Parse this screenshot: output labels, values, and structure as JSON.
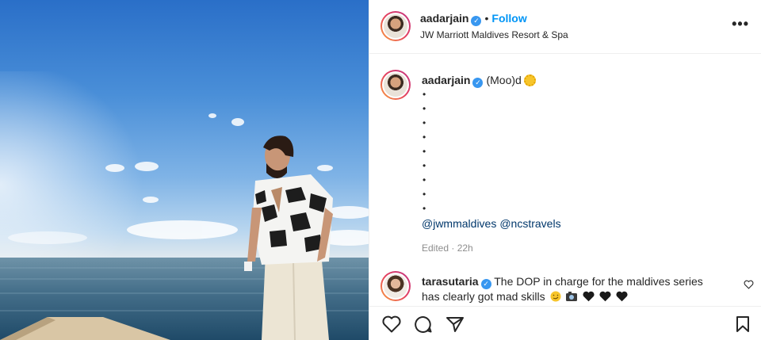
{
  "post": {
    "author": {
      "username": "aadarjain",
      "verified_mark": "✓",
      "separator": "•",
      "follow_label": "Follow",
      "location": "JW Marriott Maldives Resort & Spa"
    },
    "more_label": "•••",
    "caption": {
      "username": "aadarjain",
      "text": "(Moo)d",
      "bullets": [
        "•",
        "•",
        "•",
        "•",
        "•",
        "•",
        "•",
        "•",
        "•"
      ],
      "mentions": [
        "@jwmmaldives",
        "@ncstravels"
      ],
      "meta": "Edited · 22h"
    },
    "comment": {
      "username": "tarasutaria",
      "text": "The DOP in charge for the maldives series has clearly got mad skills",
      "emoji": [
        "smirk-emoji",
        "camera-emoji",
        "black-heart",
        "black-heart",
        "black-heart"
      ]
    },
    "actions": [
      "heart-icon",
      "comment-icon",
      "share-icon",
      "bookmark-icon"
    ],
    "colors": {
      "link": "#0095f6",
      "mention": "#00376b",
      "muted": "#8e8e8e",
      "verified": "#3897f0"
    }
  }
}
